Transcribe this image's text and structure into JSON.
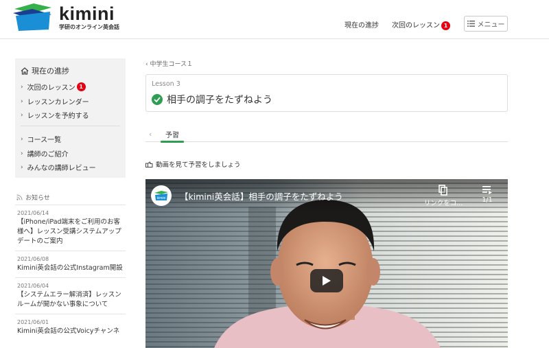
{
  "header": {
    "logo_text": "kimini",
    "logo_tagline": "学研のオンライン英会話",
    "nav_progress": "現在の進捗",
    "nav_next_lesson": "次回のレッスン",
    "next_lesson_badge": "1",
    "menu_label": "メニュー",
    "brand_colors": {
      "blue": "#1a8fd6",
      "green": "#36b04a",
      "navy": "#1b3f8f"
    }
  },
  "sidebar": {
    "title": "現在の進捗",
    "title_icon": "home-icon",
    "items_group1": [
      {
        "label": "次回のレッスン",
        "badge": "1"
      },
      {
        "label": "レッスンカレンダー"
      },
      {
        "label": "レッスンを予約する"
      }
    ],
    "items_group2": [
      {
        "label": "コース一覧"
      },
      {
        "label": "講師のご紹介"
      },
      {
        "label": "みんなの講師レビュー"
      }
    ]
  },
  "news": {
    "header": "お知らせ",
    "header_icon": "rss-icon",
    "items": [
      {
        "date": "2021/06/14",
        "title": "【iPhone/iPad端末をご利用のお客様へ】レッスン受講システムアップデートのご案内"
      },
      {
        "date": "2021/06/08",
        "title": "Kimini英会話の公式Instagram開設"
      },
      {
        "date": "2021/06/04",
        "title": "【システムエラー解消済】レッスンルームが開かない事象について"
      },
      {
        "date": "2021/06/01",
        "title": "Kimini英会話の公式Voicyチャンネ"
      }
    ]
  },
  "main": {
    "breadcrumb": "中学生コース１",
    "lesson_number": "Lesson 3",
    "lesson_title": "相手の調子をたずねよう",
    "lesson_completed": true,
    "tab_active": "予習",
    "instruction": "動画を見て予習をしましょう",
    "accent_color": "#2e9e52"
  },
  "video": {
    "title": "【kimini英会話】相手の調子をたずねよう",
    "channel_icon_text": "kimini",
    "copy_link_label": "リンクをコ...",
    "playlist_count": "1/1"
  }
}
